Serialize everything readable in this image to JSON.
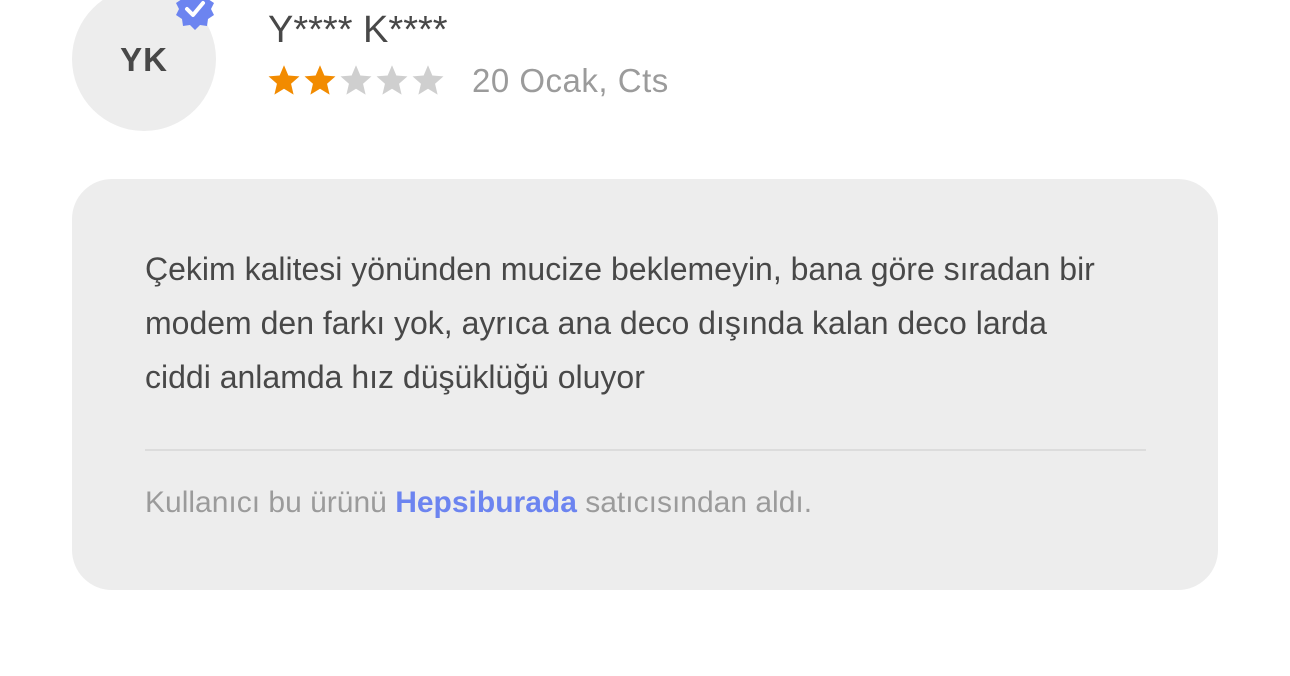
{
  "review": {
    "avatar_initials": "YK",
    "verified_icon": "verified-check-badge-icon",
    "reviewer_name": "Y**** K****",
    "rating": 2,
    "rating_max": 5,
    "date": "20 Ocak, Cts",
    "text": "Çekim kalitesi yönünden mucize beklemeyin, bana göre sıradan bir modem den farkı yok, ayrıca ana deco dışında kalan deco larda ciddi anlamda hız düşüklüğü oluyor",
    "seller_prefix": "Kullanıcı bu ürünü",
    "seller_name": "Hepsiburada",
    "seller_suffix": "satıcısından aldı."
  },
  "colors": {
    "star_filled": "#f28b00",
    "star_empty": "#cfcfcf",
    "badge": "#6c84f0",
    "link": "#6c84f0",
    "card_background": "#ededed"
  }
}
